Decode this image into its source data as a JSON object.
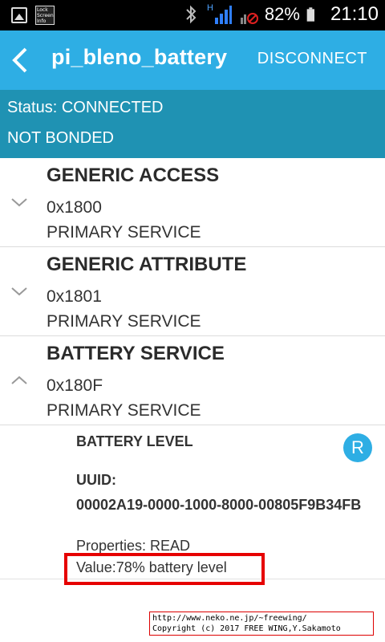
{
  "status_bar": {
    "battery_percent": "82%",
    "time": "21:10",
    "lock_info_text": "Lock Screen Info",
    "network_label": "H",
    "icons": [
      "image-icon",
      "lock-screen-info-icon",
      "bluetooth-icon",
      "signal-icon",
      "no-sim-icon",
      "battery-icon"
    ]
  },
  "app_bar": {
    "title": "pi_bleno_battery",
    "action_label": "DISCONNECT",
    "accent_color": "#2eaee4"
  },
  "status": {
    "connection": "Status: CONNECTED",
    "bond": "NOT BONDED",
    "panel_color": "#1f92b3"
  },
  "services": [
    {
      "name": "GENERIC ACCESS",
      "uuid": "0x1800",
      "type": "PRIMARY SERVICE",
      "expanded": false
    },
    {
      "name": "GENERIC ATTRIBUTE",
      "uuid": "0x1801",
      "type": "PRIMARY SERVICE",
      "expanded": false
    },
    {
      "name": "BATTERY SERVICE",
      "uuid": "0x180F",
      "type": "PRIMARY SERVICE",
      "expanded": true
    }
  ],
  "characteristic": {
    "name": "BATTERY LEVEL",
    "read_label": "R",
    "uuid_label": "UUID:",
    "uuid": "00002A19-0000-1000-8000-00805F9B34FB",
    "properties": "Properties: READ",
    "value": "Value:78% battery level"
  },
  "copyright": {
    "line1": "http://www.neko.ne.jp/~freewing/",
    "line2": "Copyright (c) 2017 FREE WING,Y.Sakamoto"
  }
}
